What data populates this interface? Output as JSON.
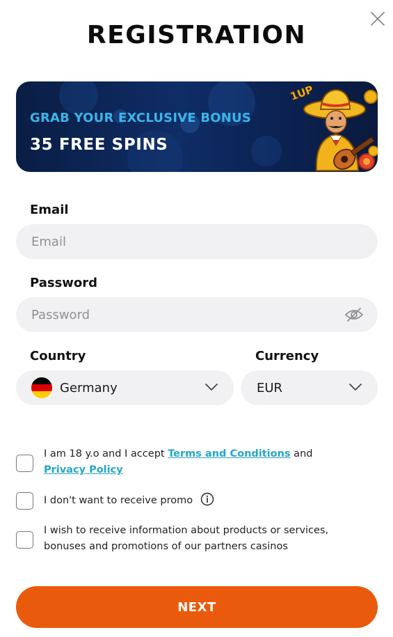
{
  "header": {
    "title": "REGISTRATION"
  },
  "banner": {
    "subtitle": "GRAB YOUR EXCLUSIVE BONUS",
    "headline": "35 FREE SPINS",
    "logo_text": "1UP"
  },
  "form": {
    "email": {
      "label": "Email",
      "placeholder": "Email",
      "value": ""
    },
    "password": {
      "label": "Password",
      "placeholder": "Password",
      "value": ""
    },
    "country": {
      "label": "Country",
      "value": "Germany",
      "flag_colors": [
        "#000000",
        "#dd0000",
        "#ffce00"
      ]
    },
    "currency": {
      "label": "Currency",
      "value": "EUR"
    }
  },
  "consents": {
    "terms": {
      "prefix": "I am 18 y.o and I accept ",
      "terms_link": "Terms and Conditions",
      "middle": " and ",
      "privacy_link": "Privacy Policy"
    },
    "promo": {
      "text": "I don't want to receive promo"
    },
    "partners": {
      "text": "I wish to receive information about products or services, bonuses and promotions of our partners casinos"
    }
  },
  "actions": {
    "next_label": "NEXT"
  },
  "colors": {
    "accent": "#ea5a0c",
    "link": "#25a7c9",
    "banner_subtitle": "#3ab6e8",
    "field_bg": "#f1f1f3"
  }
}
